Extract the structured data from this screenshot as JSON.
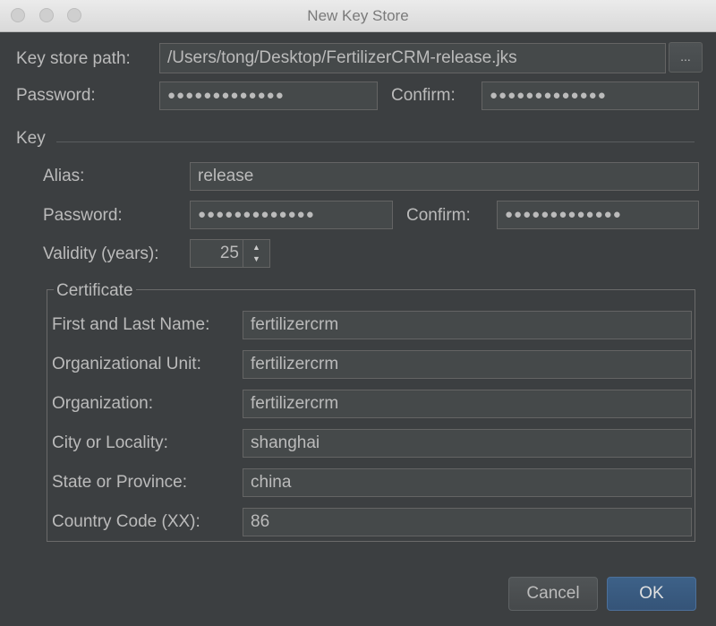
{
  "window": {
    "title": "New Key Store"
  },
  "keystore": {
    "path_label": "Key store path:",
    "path_value": "/Users/tong/Desktop/FertilizerCRM-release.jks",
    "browse_label": "...",
    "password_label": "Password:",
    "password_value": "●●●●●●●●●●●●●",
    "confirm_label": "Confirm:",
    "confirm_value": "●●●●●●●●●●●●●"
  },
  "key": {
    "section_label": "Key",
    "alias_label": "Alias:",
    "alias_value": "release",
    "password_label": "Password:",
    "password_value": "●●●●●●●●●●●●●",
    "confirm_label": "Confirm:",
    "confirm_value": "●●●●●●●●●●●●●",
    "validity_label": "Validity (years):",
    "validity_value": "25"
  },
  "certificate": {
    "legend": "Certificate",
    "fields": [
      {
        "label": "First and Last Name:",
        "value": "fertilizercrm"
      },
      {
        "label": "Organizational Unit:",
        "value": "fertilizercrm"
      },
      {
        "label": "Organization:",
        "value": "fertilizercrm"
      },
      {
        "label": "City or Locality:",
        "value": "shanghai"
      },
      {
        "label": "State or Province:",
        "value": "china"
      },
      {
        "label": "Country Code (XX):",
        "value": "86"
      }
    ]
  },
  "buttons": {
    "cancel": "Cancel",
    "ok": "OK"
  },
  "icons": {
    "spinner": "up-down-arrows-icon",
    "window_controls": "traffic-light-icon"
  },
  "colors": {
    "background": "#3c3f41",
    "field_bg": "#45494a",
    "ok_button": "#365880"
  }
}
